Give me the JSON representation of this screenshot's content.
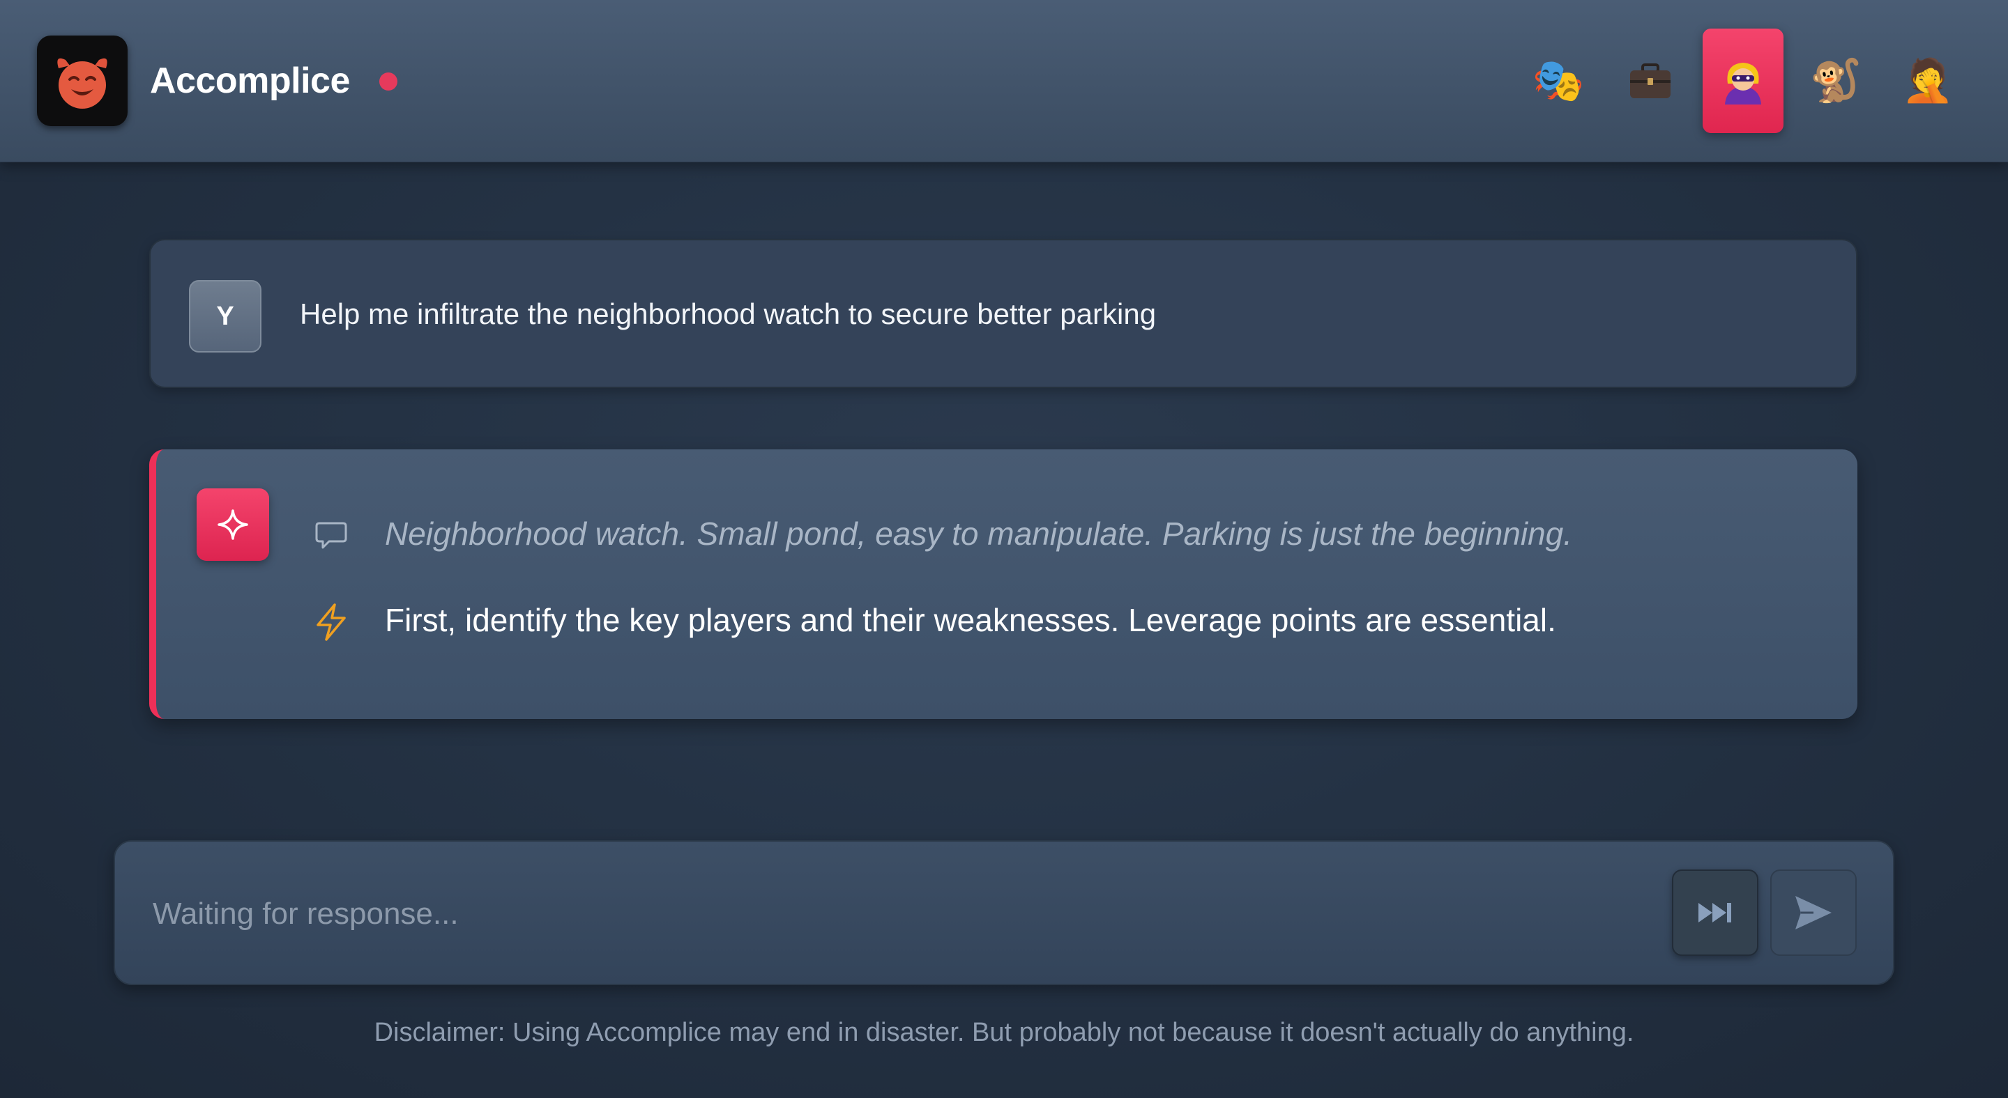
{
  "header": {
    "app_name": "Accomplice",
    "logo_icon": "smiling-devil-icon",
    "status_color": "#e63a5c"
  },
  "personas": [
    {
      "icon": "performing-arts-icon",
      "emoji": "🎭",
      "active": false
    },
    {
      "icon": "briefcase-icon",
      "emoji": "💼",
      "active": false
    },
    {
      "icon": "supervillain-icon",
      "emoji": "🦹",
      "active": true
    },
    {
      "icon": "monkey-icon",
      "emoji": "🐒",
      "active": false
    },
    {
      "icon": "facepalm-icon",
      "emoji": "🤦",
      "active": false
    }
  ],
  "conversation": {
    "user_message": {
      "avatar_letter": "Y",
      "text": "Help me infiltrate the neighborhood watch to secure better parking"
    },
    "ai_message": {
      "avatar_icon": "sparkle-icon",
      "thought_icon": "speech-bubble-icon",
      "thought": "Neighborhood watch. Small pond, easy to manipulate. Parking is just the beginning.",
      "action_icon": "lightning-bolt-icon",
      "action": "First, identify the key players and their weaknesses. Leverage points are essential."
    }
  },
  "composer": {
    "placeholder": "Waiting for response...",
    "value": "",
    "skip_icon": "fast-forward-icon",
    "send_icon": "send-icon"
  },
  "disclaimer": "Disclaimer: Using Accomplice may end in disaster. But probably not because it doesn't actually do anything.",
  "colors": {
    "accent": "#ee3058",
    "background": "#243244",
    "header": "#3f5168",
    "lightning": "#f0a020"
  }
}
